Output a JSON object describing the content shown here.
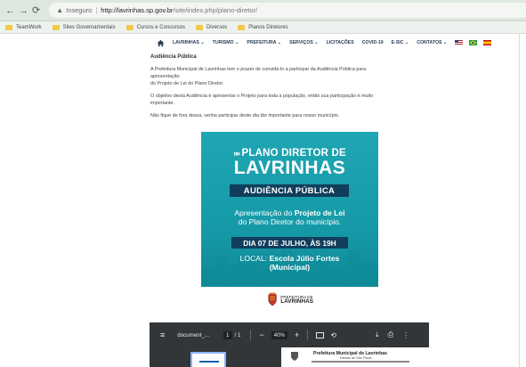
{
  "browser": {
    "insecure_label": "Inseguro",
    "separator": "|",
    "url_host": "http://lavrinhas.sp.gov.br",
    "url_path": "/site/index.php/plano-diretor/",
    "bookmarks": [
      {
        "label": "TeamWork"
      },
      {
        "label": "Sites Governamentais"
      },
      {
        "label": "Cursos e Concursos"
      },
      {
        "label": "Diversos"
      },
      {
        "label": "Planos Diretores"
      }
    ]
  },
  "site_nav": {
    "items": [
      {
        "label": "LAVRINHAS ⌄"
      },
      {
        "label": "TURISMO ⌄"
      },
      {
        "label": "PREFEITURA ⌄"
      },
      {
        "label": "SERVIÇOS ⌄"
      },
      {
        "label": "LICITAÇÕES"
      },
      {
        "label": "COVID-19"
      },
      {
        "label": "E-SIC ⌄"
      },
      {
        "label": "CONTATOS ⌄"
      }
    ]
  },
  "content": {
    "heading": "Audiência Pública",
    "paragraphs": [
      "A Prefeitura Municipal de Lavrinhas tem o prazer de convidá-lo a participar da Audiência Pública para",
      "apresentação",
      "do Projeto de Lei do Plano Diretor.",
      "O objetivo desta Audiência é apresentar o Projeto para toda a população, então sua participação é muito",
      "importante.",
      "Não fique de fora dessa, venha participar deste dia tão importante para nosso município."
    ]
  },
  "poster": {
    "chevrons": "»»",
    "line1": "PLANO DIRETOR DE",
    "line2": "LAVRINHAS",
    "badge": "AUDIÊNCIA PÚBLICA",
    "sub1_pre": "Apresentação do ",
    "sub1_bold": "Projeto de Lei",
    "sub2": "do Plano Diretor do município.",
    "date": "DIA 07 DE JULHO, ÀS 19H",
    "local_label": "LOCAL: ",
    "local_bold": "Escola Júlio Fortes",
    "local_2": "(Municipal)"
  },
  "logo": {
    "small": "PREFEITURA DE",
    "big": "LAVRINHAS"
  },
  "pdf": {
    "title": "document_...",
    "page": "1",
    "total": "/ 1",
    "zoom": "40%",
    "doc_title": "Prefeitura Municipal de Lavrinhas",
    "doc_sub": "Estado de São Paulo"
  },
  "colors": {
    "poster_teal": "#1fa6b3",
    "poster_navy": "#103e5c",
    "nav_text": "#2a3d57",
    "pdf_toolbar": "#323639"
  }
}
